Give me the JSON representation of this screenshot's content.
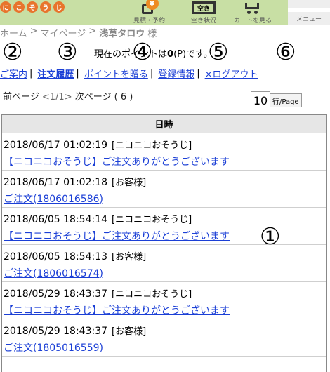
{
  "header": {
    "logo_chars": [
      "に",
      "こ",
      "そ",
      "う",
      "じ"
    ],
    "nav": [
      {
        "label": "見積・予約",
        "icon": "yen-icon",
        "icon_text": "¥"
      },
      {
        "label": "空き状況",
        "icon": "calendar-icon",
        "icon_text": "空き"
      },
      {
        "label": "カートを見る",
        "icon": "cart-icon"
      }
    ],
    "menu_label": "メニュー",
    "colors": {
      "background": "#c8dfa4",
      "accent": "#ee8b24"
    }
  },
  "breadcrumb": {
    "home": "ホーム",
    "sep": ">",
    "mypage": "マイページ",
    "user": "浅草タロウ",
    "suffix": "様"
  },
  "annotations": [
    "②",
    "③",
    "④",
    "⑤",
    "⑥",
    "①"
  ],
  "points": {
    "prefix": "現在のポイントは",
    "value": "0",
    "unit": "(P)",
    "suffix": "です。"
  },
  "nav": {
    "items": [
      {
        "label": "ご案内",
        "active": false
      },
      {
        "label": "注文履歴",
        "active": true
      },
      {
        "label": "ポイントを贈る",
        "active": false
      },
      {
        "label": "登録情報",
        "active": false
      },
      {
        "label": "×ログアウト",
        "active": false
      }
    ],
    "separator": "|"
  },
  "pager": {
    "prev": "前ページ",
    "page": "<1/1>",
    "next": "次ページ",
    "count": "( 6 )"
  },
  "per_page": {
    "value": "10",
    "unit": "行/Page"
  },
  "table": {
    "header": "日時",
    "rows": [
      {
        "datetime": "2018/06/17 01:02:19",
        "sender": "[ニコニコおそうじ]",
        "link": "【ニコニコおそうじ】ご注文ありがとうございます"
      },
      {
        "datetime": "2018/06/17 01:02:18",
        "sender": "[お客様]",
        "link": "ご注文(1806016586)"
      },
      {
        "datetime": "2018/06/05 18:54:14",
        "sender": "[ニコニコおそうじ]",
        "link": "【ニコニコおそうじ】ご注文ありがとうございます"
      },
      {
        "datetime": "2018/06/05 18:54:13",
        "sender": "[お客様]",
        "link": "ご注文(1806016574)"
      },
      {
        "datetime": "2018/05/29 18:43:37",
        "sender": "[ニコニコおそうじ]",
        "link": "【ニコニコおそうじ】ご注文ありがとうございます"
      },
      {
        "datetime": "2018/05/29 18:43:37",
        "sender": "[お客様]",
        "link": "ご注文(1805016559)"
      }
    ]
  }
}
